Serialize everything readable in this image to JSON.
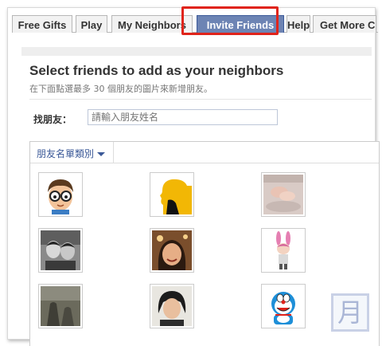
{
  "tabs": [
    {
      "label": "Free Gifts",
      "active": false
    },
    {
      "label": "Play",
      "active": false
    },
    {
      "label": "My Neighbors",
      "active": false
    },
    {
      "label": "Invite Friends",
      "active": true
    },
    {
      "label": "Help",
      "active": false
    },
    {
      "label": "Get More C",
      "active": false
    }
  ],
  "colors": {
    "active_tab": "#6d84b4",
    "highlight_box": "#e0241b",
    "link": "#3b5998"
  },
  "panel": {
    "title": "Select friends to add as your neighbors",
    "subtitle": "在下面點選最多 30 個朋友的圖片來新增朋友。"
  },
  "search": {
    "label": "找朋友：",
    "placeholder": "請輸入朋友姓名"
  },
  "friend_list": {
    "category_label": "朋友名單類別",
    "friends": [
      {
        "icon": "cartoon-boy-glasses"
      },
      {
        "icon": "yellow-silhouette"
      },
      {
        "icon": "baby-photo"
      },
      {
        "icon": "two-boys-photo"
      },
      {
        "icon": "smiling-woman-photo"
      },
      {
        "icon": "rabbit-girl-avatar"
      },
      {
        "icon": "outdoor-photo"
      },
      {
        "icon": "young-person-photo"
      },
      {
        "icon": "doraemon-avatar"
      }
    ]
  },
  "watermark": {
    "glyph": "月"
  }
}
